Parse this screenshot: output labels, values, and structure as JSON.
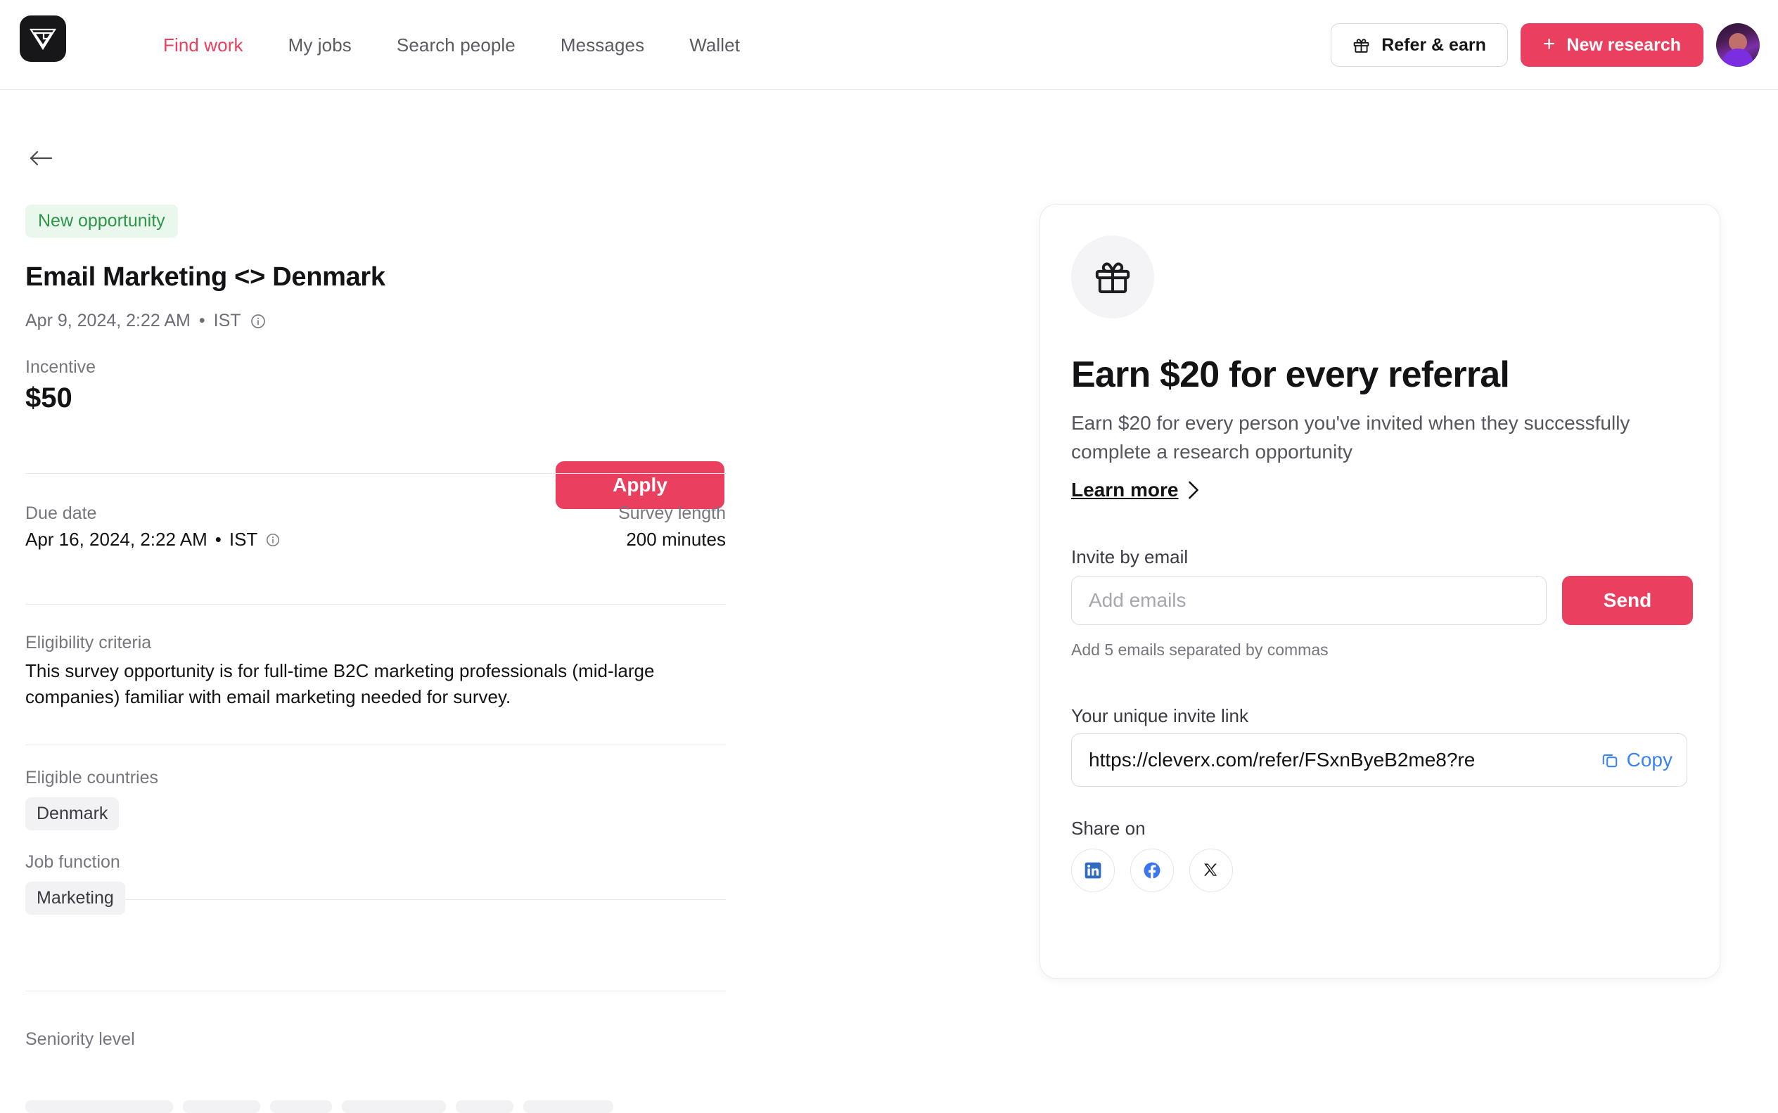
{
  "header": {
    "logo_name": "cleverx-logo",
    "nav": [
      {
        "label": "Find work",
        "active": true
      },
      {
        "label": "My jobs",
        "active": false
      },
      {
        "label": "Search people",
        "active": false
      },
      {
        "label": "Messages",
        "active": false
      },
      {
        "label": "Wallet",
        "active": false
      }
    ],
    "refer_button": "Refer & earn",
    "new_research_button": "New research",
    "new_research_plus": "+"
  },
  "job": {
    "badge": "New opportunity",
    "title": "Email Marketing <> Denmark",
    "posted_date": "Apr 9, 2024, 2:22 AM",
    "posted_bullet": "•",
    "posted_timezone": "IST",
    "incentive_label": "Incentive",
    "incentive_value": "$50",
    "apply_label": "Apply",
    "due_date_label": "Due date",
    "due_date_value": "Apr 16, 2024, 2:22 AM",
    "due_date_bullet": "•",
    "due_date_timezone": "IST",
    "survey_length_label": "Survey length",
    "survey_length_value": "200 minutes",
    "eligibility_label": "Eligibility criteria",
    "eligibility_text": "This survey opportunity is for full-time B2C marketing professionals (mid-large companies) familiar with email marketing needed for survey.",
    "countries_label": "Eligible countries",
    "countries": [
      "Denmark"
    ],
    "job_function_label": "Job function",
    "job_functions": [
      "Marketing"
    ],
    "seniority_label": "Seniority level",
    "seniority_levels": [
      "",
      "",
      "",
      "",
      "",
      ""
    ]
  },
  "referral": {
    "title": "Earn $20 for every referral",
    "subtitle": "Earn $20 for every person you've invited when they successfully complete a research opportunity",
    "learn_more": "Learn more",
    "invite_label": "Invite by email",
    "email_placeholder": "Add emails",
    "email_value": "",
    "send_label": "Send",
    "invite_hint": "Add 5 emails separated by commas",
    "link_label": "Your unique invite link",
    "link_value": "https://cleverx.com/refer/FSxnByeB2me8?re",
    "copy_label": "Copy",
    "share_label": "Share on",
    "share_targets": [
      "linkedin",
      "facebook",
      "x-twitter"
    ]
  },
  "colors": {
    "accent_red": "#ea3f5e",
    "badge_green_text": "#2e9648",
    "badge_green_bg": "#e9f7ec",
    "link_blue": "#3b82f6",
    "chip_bg": "#f2f2f4"
  }
}
